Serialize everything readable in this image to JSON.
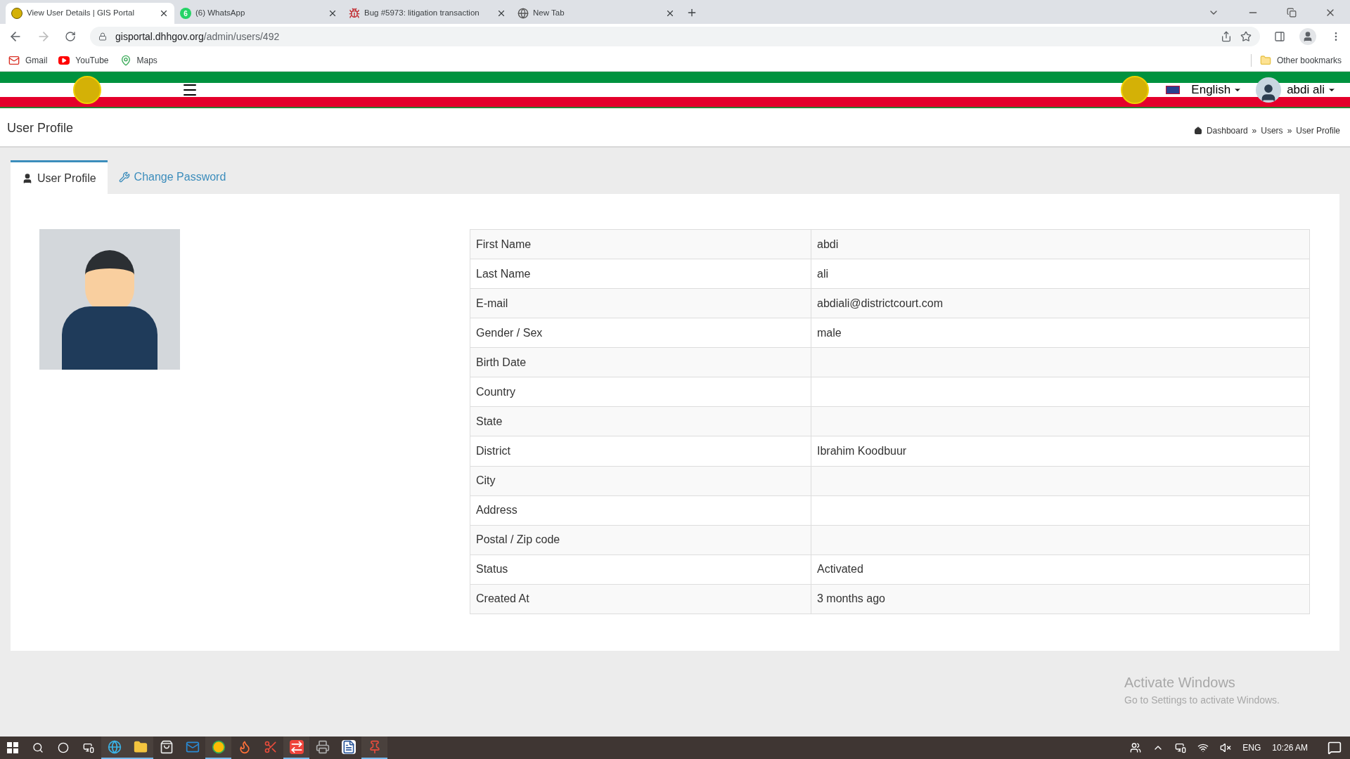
{
  "browser": {
    "tabs": [
      {
        "title": "View User Details | GIS Portal",
        "selected": true,
        "kind": "emblem"
      },
      {
        "title": "(6) WhatsApp",
        "selected": false,
        "kind": "chat",
        "badge": "6"
      },
      {
        "title": "Bug #5973: litigation transaction",
        "selected": false,
        "kind": "bug"
      },
      {
        "title": "New Tab",
        "selected": false,
        "kind": "globe"
      }
    ],
    "url": {
      "host": "gisportal.dhhgov.org",
      "path": "/admin/users/492"
    },
    "bookmarks": [
      {
        "label": "Gmail",
        "kind": "mail"
      },
      {
        "label": "YouTube",
        "kind": "video"
      },
      {
        "label": "Maps",
        "kind": "pin"
      }
    ],
    "other_bookmarks": "Other bookmarks"
  },
  "header": {
    "language": "English",
    "user": "abdi ali"
  },
  "page": {
    "title": "User Profile",
    "breadcrumb": [
      "Dashboard",
      "Users",
      "User Profile"
    ],
    "separator": "»"
  },
  "tabs": [
    {
      "label": "User Profile",
      "selected": true,
      "kind": "user"
    },
    {
      "label": "Change Password",
      "selected": false,
      "kind": "wrench"
    }
  ],
  "profile": {
    "rows": [
      {
        "label": "First Name",
        "value": "abdi"
      },
      {
        "label": "Last Name",
        "value": "ali"
      },
      {
        "label": "E-mail",
        "value": "abdiali@districtcourt.com"
      },
      {
        "label": "Gender / Sex",
        "value": "male"
      },
      {
        "label": "Birth Date"
      },
      {
        "label": "Country"
      },
      {
        "label": "State"
      },
      {
        "label": "District",
        "value": "Ibrahim Koodbuur"
      },
      {
        "label": "City"
      },
      {
        "label": "Address"
      },
      {
        "label": "Postal / Zip code"
      },
      {
        "label": "Status",
        "value": "Activated"
      },
      {
        "label": "Created At",
        "value": "3 months ago"
      }
    ]
  },
  "activation_notice": {
    "title": "Activate Windows",
    "text": "Go to Settings to activate Windows."
  },
  "taskbar": {
    "apps": [
      {
        "kind": "browser",
        "running": true
      },
      {
        "kind": "folder",
        "running": true
      },
      {
        "kind": "store",
        "running": false
      },
      {
        "kind": "mail",
        "running": false
      },
      {
        "kind": "globe",
        "running": true
      },
      {
        "kind": "fox",
        "running": false
      },
      {
        "kind": "scissors",
        "running": false
      },
      {
        "kind": "remote",
        "running": true
      },
      {
        "kind": "scanner",
        "running": false
      },
      {
        "kind": "document",
        "running": false
      },
      {
        "kind": "tool",
        "running": true
      }
    ],
    "language": "ENG",
    "time": "10:26 AM"
  }
}
